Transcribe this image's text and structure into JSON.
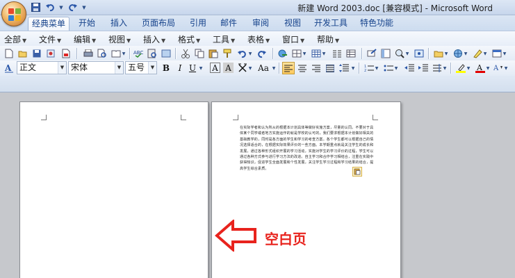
{
  "window": {
    "title": "新建 Word 2003.doc [兼容模式] - Microsoft Word"
  },
  "quick_access": {
    "items": [
      "save-icon",
      "undo-icon",
      "redo-icon"
    ]
  },
  "ribbon_tabs": [
    {
      "label": "经典菜单",
      "active": true
    },
    {
      "label": "开始"
    },
    {
      "label": "插入"
    },
    {
      "label": "页面布局"
    },
    {
      "label": "引用"
    },
    {
      "label": "邮件"
    },
    {
      "label": "审阅"
    },
    {
      "label": "视图"
    },
    {
      "label": "开发工具"
    },
    {
      "label": "特色功能"
    }
  ],
  "menu": [
    {
      "label": "全部"
    },
    {
      "label": "文件"
    },
    {
      "label": "编辑"
    },
    {
      "label": "视图"
    },
    {
      "label": "插入"
    },
    {
      "label": "格式"
    },
    {
      "label": "工具"
    },
    {
      "label": "表格"
    },
    {
      "label": "窗口"
    },
    {
      "label": "帮助"
    }
  ],
  "format_toolbar": {
    "style_value": "正文",
    "font_value": "宋体",
    "size_value": "五号",
    "bold_label": "B",
    "italic_label": "I",
    "underline_label": "U",
    "char_shade_label": "A",
    "char_border_label": "A",
    "case_label": "Aa"
  },
  "document": {
    "page2_text": "在实际学者和认为所从的根据本计划具体等做好实施方案，尽量的认同。不要对于具体某个同学或者地方实施运作的就是学校的认可的，我们要求根据本计划做好相关的基础教学的，同时是各方面的学生和学习的考查方案。各个学生都可以根据自己的情况选择适合的，在根据实际效果评价的一些方面。本学期重点就是关注学生的成长和发展，通过各种形式组织开展的学习活动，实施对学生的学习评价的过程，学生可以通过各种方式参与进行学习方法的改进。自主学习和合作学习相结合，注重在实践中获得知识，促进学生全面发展和个性发展，关注学生学习过程和学习结果的结合，提高学生综合素质。",
    "annotation_label": "空白页"
  },
  "colors": {
    "annotation": "#e8231d",
    "ribbon_text": "#15428b"
  }
}
